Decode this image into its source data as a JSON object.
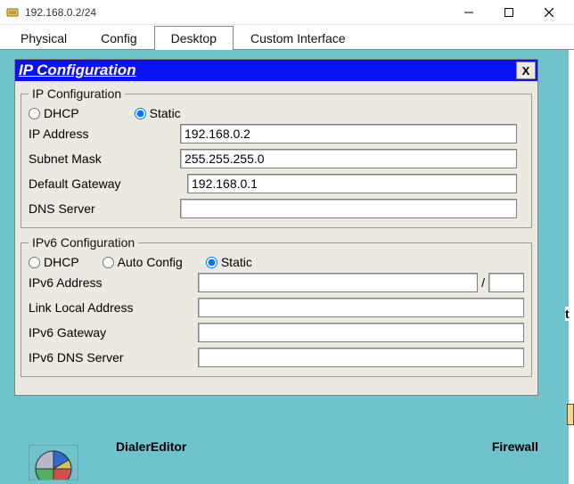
{
  "window": {
    "title": "192.168.0.2/24"
  },
  "tabs": {
    "items": [
      {
        "label": "Physical",
        "active": false
      },
      {
        "label": "Config",
        "active": false
      },
      {
        "label": "Desktop",
        "active": true
      },
      {
        "label": "Custom Interface",
        "active": false
      }
    ]
  },
  "dialog": {
    "title": "IP Configuration",
    "close_label": "X"
  },
  "ipv4": {
    "legend": "IP Configuration",
    "radio_dhcp": "DHCP",
    "radio_static": "Static",
    "selected": "static",
    "ip_label": "IP Address",
    "ip_value": "192.168.0.2",
    "mask_label": "Subnet Mask",
    "mask_value": "255.255.255.0",
    "gw_label": "Default Gateway",
    "gw_value": "192.168.0.1",
    "dns_label": "DNS Server",
    "dns_value": ""
  },
  "ipv6": {
    "legend": "IPv6 Configuration",
    "radio_dhcp": "DHCP",
    "radio_auto": "Auto Config",
    "radio_static": "Static",
    "selected": "static",
    "addr_label": "IPv6 Address",
    "addr_value": "",
    "prefix_value": "",
    "linklocal_label": "Link Local Address",
    "linklocal_value": "",
    "gw_label": "IPv6 Gateway",
    "gw_value": "",
    "dns_label": "IPv6 DNS Server",
    "dns_value": ""
  },
  "background": {
    "label_dialer": "Dialer",
    "label_editor": "Editor",
    "label_firewall": "Firewall",
    "peek_te": "t"
  }
}
